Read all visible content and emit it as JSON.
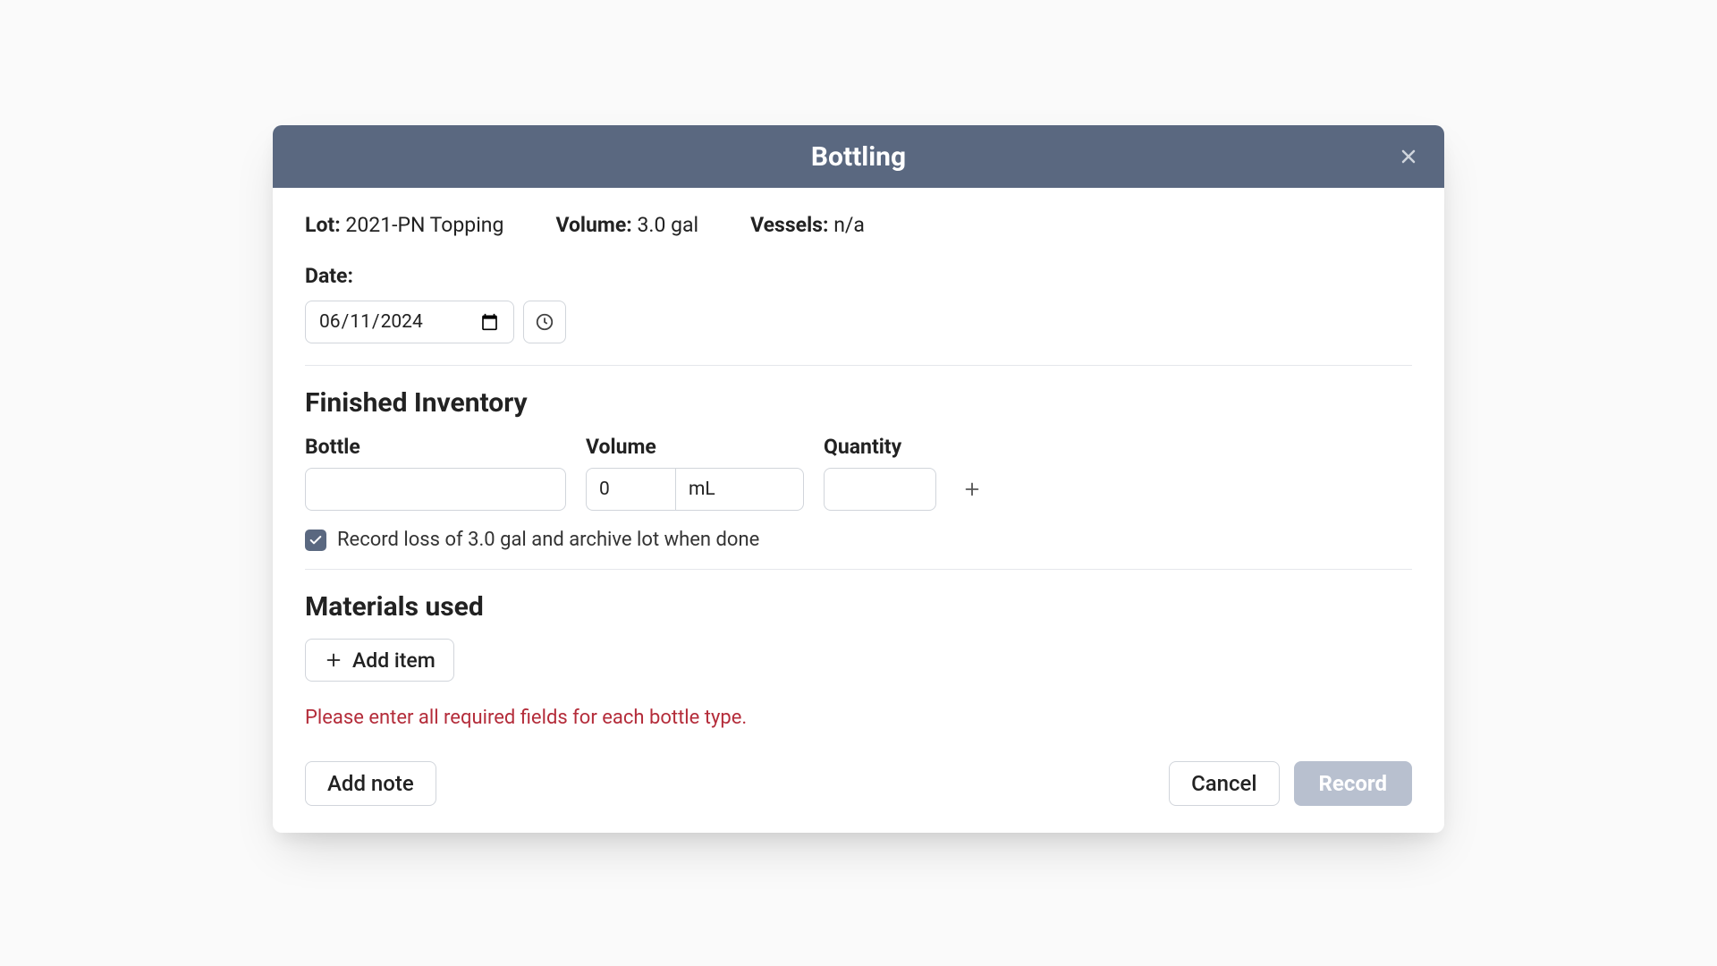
{
  "modal": {
    "title": "Bottling"
  },
  "info": {
    "lot_label": "Lot:",
    "lot_value": "2021-PN Topping",
    "volume_label": "Volume:",
    "volume_value": "3.0 gal",
    "vessels_label": "Vessels:",
    "vessels_value": "n/a"
  },
  "date": {
    "label": "Date:",
    "value": "2024-06-11"
  },
  "inventory": {
    "section_title": "Finished Inventory",
    "bottle_label": "Bottle",
    "volume_label": "Volume",
    "quantity_label": "Quantity",
    "bottle_value": "",
    "volume_value": "0",
    "volume_unit": "mL",
    "quantity_value": "",
    "checkbox_label": "Record loss of 3.0 gal and archive lot when done"
  },
  "materials": {
    "section_title": "Materials used",
    "add_item_label": "Add item"
  },
  "validation": {
    "message": "Please enter all required fields for each bottle type."
  },
  "footer": {
    "add_note_label": "Add note",
    "cancel_label": "Cancel",
    "record_label": "Record"
  }
}
